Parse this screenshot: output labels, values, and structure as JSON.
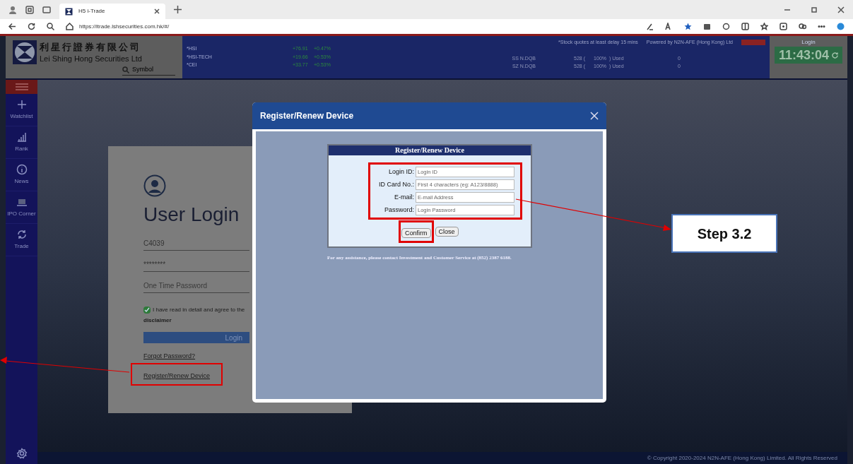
{
  "browser": {
    "tab_title": "H5 i-Trade",
    "url": "https://itrade.lshsecurities.com.hk/#/"
  },
  "header": {
    "company_name_zh": "利星行證券有限公司",
    "company_name_en": "Lei Shing Hong Securities Ltd",
    "search_placeholder": "Symbol",
    "indices": [
      {
        "name": "*HSI",
        "change": "+76.91",
        "percent": "+0.47%"
      },
      {
        "name": "*HSI-TECH",
        "change": "+19.66",
        "percent": "+0.53%"
      },
      {
        "name": "*CEI",
        "change": "+33.77",
        "percent": "+0.53%"
      }
    ],
    "notice": "*Stock quotes at least delay 15 mins",
    "powered_by": "Powered by N2N-AFE (Hong Kong) Ltd",
    "quotas": [
      {
        "market": "SS N.DQB",
        "count": "528 (",
        "percent": "100%",
        "used": ") Used",
        "value": "0"
      },
      {
        "market": "SZ N.DQB",
        "count": "528 (",
        "percent": "100%",
        "used": ") Used",
        "value": "0"
      }
    ],
    "login_label": "Login",
    "clock": "11:43:04"
  },
  "sidebar": {
    "items": [
      {
        "label": "Watchlist"
      },
      {
        "label": "Rank"
      },
      {
        "label": "News"
      },
      {
        "label": "IPO Corner"
      },
      {
        "label": "Trade"
      }
    ]
  },
  "login": {
    "title": "User Login",
    "user_id": "C4039",
    "password": "********",
    "otp_placeholder": "One Time Password",
    "agree_checked": true,
    "agree_text": "I have read in detail and agree to the",
    "disclaimer": "disclaimer",
    "login_button": "Login",
    "forgot_link": "Forgot Password?",
    "register_link": "Register/Renew Device"
  },
  "modal": {
    "title": "Register/Renew Device",
    "panel_title": "Register/Renew Device",
    "fields": [
      {
        "label": "Login ID:",
        "placeholder": "Login ID"
      },
      {
        "label": "ID Card No.:",
        "placeholder": "First 4 characters (eg: A123/8888)"
      },
      {
        "label": "E-mail:",
        "placeholder": "E-mail Address"
      },
      {
        "label": "Password:",
        "placeholder": "Login Password"
      }
    ],
    "buttons": [
      "Confirm",
      "Close"
    ],
    "note": "For any assistance, please contact Investment and Customer Service at (852) 2387 6188."
  },
  "annotation": {
    "step": "Step 3.2"
  },
  "footer": {
    "copyright": "© Copyright 2020-2024 N2N-AFE (Hong Kong) Limited. All Rights Reserved"
  }
}
